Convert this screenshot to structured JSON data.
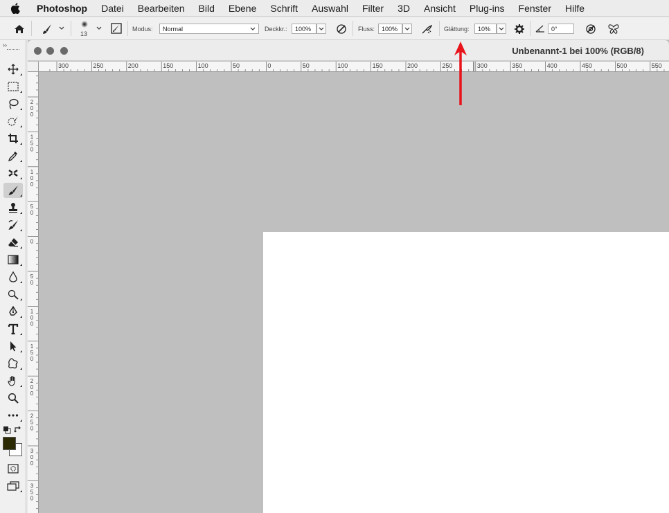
{
  "menubar": {
    "apple_icon": "apple-icon",
    "items": [
      "Photoshop",
      "Datei",
      "Bearbeiten",
      "Bild",
      "Ebene",
      "Schrift",
      "Auswahl",
      "Filter",
      "3D",
      "Ansicht",
      "Plug-ins",
      "Fenster",
      "Hilfe"
    ]
  },
  "options": {
    "brush_size": "13",
    "mode_label": "Modus:",
    "mode_value": "Normal",
    "opacity_label": "Deckkr.:",
    "opacity_value": "100%",
    "flow_label": "Fluss:",
    "flow_value": "100%",
    "smoothing_label": "Glättung:",
    "smoothing_value": "10%",
    "angle_value": "0°"
  },
  "toolbar": {
    "collapse_glyph": "››",
    "tools": [
      "move-tool",
      "rect-marquee-tool",
      "lasso-tool",
      "quick-select-tool",
      "crop-tool",
      "eyedropper-tool",
      "healing-tool",
      "brush-tool",
      "stamp-tool",
      "history-brush-tool",
      "eraser-tool",
      "gradient-tool",
      "blur-tool",
      "dodge-tool",
      "pen-tool",
      "type-tool",
      "path-select-tool",
      "shape-tool",
      "hand-tool",
      "zoom-tool",
      "more-tools"
    ],
    "active_tool": "brush-tool",
    "foreground_color": "#2b2a05",
    "background_color": "#ffffff"
  },
  "document": {
    "title": "Unbenannt-1 bei 100% (RGB/8)",
    "h_ruler_labels": [
      "300",
      "250",
      "200",
      "150",
      "100",
      "50",
      "0",
      "50",
      "100",
      "150",
      "200",
      "250",
      "300",
      "350",
      "400",
      "450",
      "500",
      "550"
    ],
    "v_ruler_labels": [
      "200",
      "150",
      "100",
      "50",
      "0",
      "50",
      "100",
      "150",
      "200",
      "250",
      "300",
      "350"
    ]
  },
  "annotation": {
    "color": "#e8141b",
    "target": "smoothing-field"
  }
}
